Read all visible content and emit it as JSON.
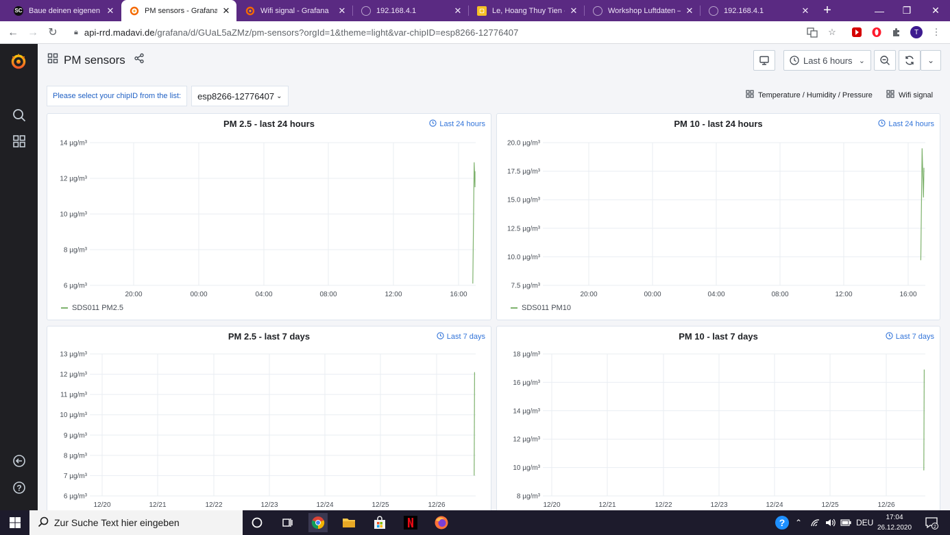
{
  "browser": {
    "tabs": [
      {
        "title": "Baue deinen eigenen F",
        "active": false
      },
      {
        "title": "PM sensors - Grafana",
        "active": true
      },
      {
        "title": "Wifi signal - Grafana",
        "active": false
      },
      {
        "title": "192.168.4.1",
        "active": false
      },
      {
        "title": "Le, Hoang Thuy Tien - ",
        "active": false
      },
      {
        "title": "Workshop Luftdaten – ",
        "active": false
      },
      {
        "title": "192.168.4.1",
        "active": false
      }
    ],
    "url_domain": "api-rrd.madavi.de",
    "url_path": "/grafana/d/GUaL5aZMz/pm-sensors?orgId=1&theme=light&var-chipID=esp8266-12776407",
    "profile_initial": "T"
  },
  "dashboard": {
    "title": "PM sensors",
    "time_range_label": "Last 6 hours",
    "variable_label": "Please select your chipID from the list:",
    "variable_value": "esp8266-12776407",
    "links": [
      "Temperature / Humidity / Pressure",
      "Wifi signal"
    ]
  },
  "panels": [
    {
      "title": "PM 2.5 - last 24 hours",
      "time_override": "Last 24 hours",
      "legend": "SDS011 PM2.5"
    },
    {
      "title": "PM 10 - last 24 hours",
      "time_override": "Last 24 hours",
      "legend": "SDS011 PM10"
    },
    {
      "title": "PM 2.5 - last 7 days",
      "time_override": "Last 7 days"
    },
    {
      "title": "PM 10 - last 7 days",
      "time_override": "Last 7 days"
    }
  ],
  "chart_data": [
    {
      "type": "line",
      "title": "PM 2.5 - last 24 hours",
      "x_ticks": [
        "20:00",
        "00:00",
        "04:00",
        "08:00",
        "12:00",
        "16:00"
      ],
      "y_ticks": [
        "6 µg/m³",
        "8 µg/m³",
        "10 µg/m³",
        "12 µg/m³",
        "14 µg/m³"
      ],
      "ylim": [
        6,
        14
      ],
      "series": [
        {
          "name": "SDS011 PM2.5",
          "color": "#7eb26d",
          "x": [
            "16:50",
            "16:55",
            "17:00",
            "17:02"
          ],
          "y": [
            6.1,
            12.9,
            11.5,
            12.4
          ]
        }
      ],
      "grid": true
    },
    {
      "type": "line",
      "title": "PM 10 - last 24 hours",
      "x_ticks": [
        "20:00",
        "00:00",
        "04:00",
        "08:00",
        "12:00",
        "16:00"
      ],
      "y_ticks": [
        "7.5 µg/m³",
        "10.0 µg/m³",
        "12.5 µg/m³",
        "15.0 µg/m³",
        "17.5 µg/m³",
        "20.0 µg/m³"
      ],
      "ylim": [
        7.5,
        20
      ],
      "series": [
        {
          "name": "SDS011 PM10",
          "color": "#7eb26d",
          "x": [
            "16:50",
            "16:55",
            "17:00",
            "17:02"
          ],
          "y": [
            9.7,
            19.5,
            15.2,
            17.8
          ]
        }
      ],
      "grid": true
    },
    {
      "type": "line",
      "title": "PM 2.5 - last 7 days",
      "x_ticks": [
        "12/20",
        "12/21",
        "12/22",
        "12/23",
        "12/24",
        "12/25",
        "12/26"
      ],
      "y_ticks": [
        "6 µg/m³",
        "7 µg/m³",
        "8 µg/m³",
        "9 µg/m³",
        "10 µg/m³",
        "11 µg/m³",
        "12 µg/m³",
        "13 µg/m³"
      ],
      "ylim": [
        6,
        13
      ],
      "series": [
        {
          "name": "SDS011 PM2.5",
          "color": "#7eb26d",
          "x": [
            "12/26 16:50",
            "12/26 17:00"
          ],
          "y": [
            7.0,
            12.1
          ]
        }
      ],
      "grid": true
    },
    {
      "type": "line",
      "title": "PM 10 - last 7 days",
      "x_ticks": [
        "12/20",
        "12/21",
        "12/22",
        "12/23",
        "12/24",
        "12/25",
        "12/26"
      ],
      "y_ticks": [
        "8 µg/m³",
        "10 µg/m³",
        "12 µg/m³",
        "14 µg/m³",
        "16 µg/m³",
        "18 µg/m³"
      ],
      "ylim": [
        8,
        18
      ],
      "series": [
        {
          "name": "SDS011 PM10",
          "color": "#7eb26d",
          "x": [
            "12/26 16:50",
            "12/26 17:00"
          ],
          "y": [
            9.8,
            16.9
          ]
        }
      ],
      "grid": true
    }
  ],
  "taskbar": {
    "search_placeholder": "Zur Suche Text hier eingeben",
    "language": "DEU",
    "time": "17:04",
    "date": "26.12.2020",
    "notification_count": "2"
  }
}
